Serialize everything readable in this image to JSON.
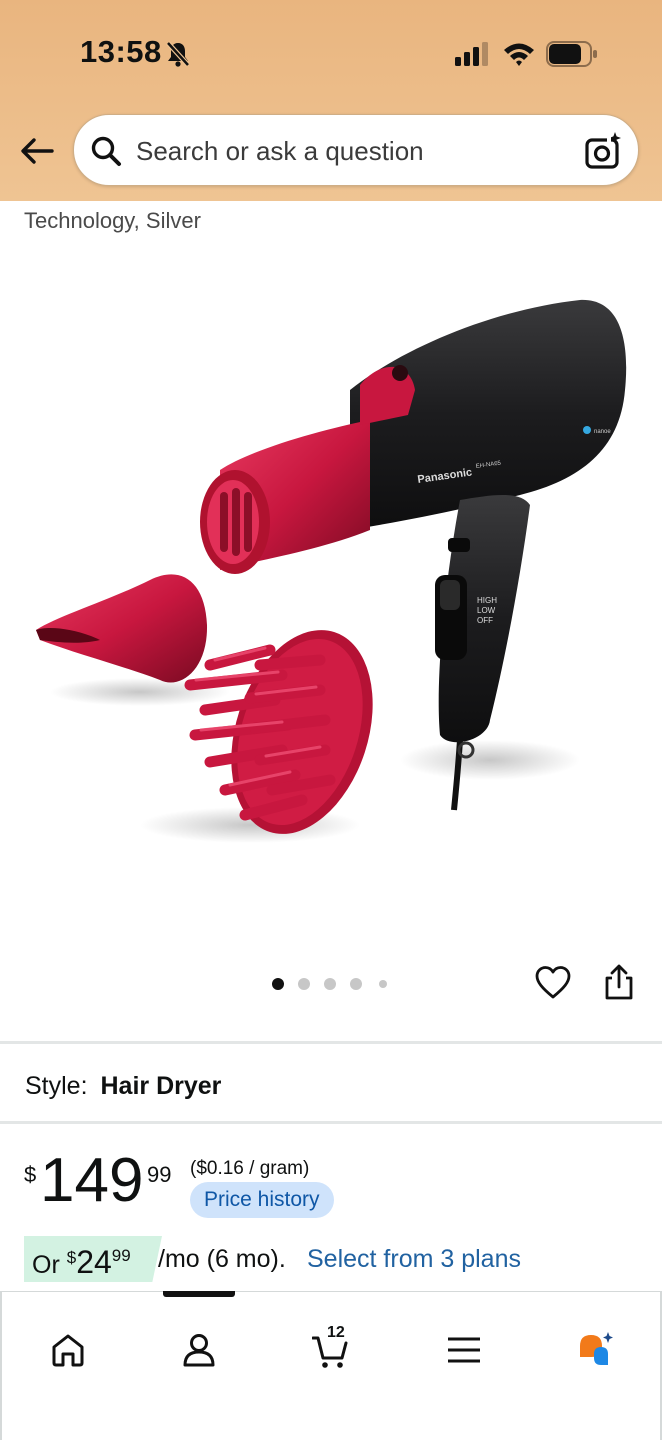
{
  "status_bar": {
    "time": "13:58"
  },
  "search": {
    "placeholder": "Search or ask a question"
  },
  "product": {
    "title_tail": "Technology, Silver",
    "style_label": "Style:",
    "style_value": "Hair Dryer",
    "image_count": 5,
    "active_image_index": 0
  },
  "price": {
    "symbol": "$",
    "whole": "149",
    "fraction": "99",
    "unit_price": "($0.16 / gram)",
    "price_history_label": "Price history"
  },
  "installment": {
    "prefix": "Or",
    "symbol": "$",
    "whole": "24",
    "fraction": "99",
    "term": "/mo (6 mo).",
    "select_plans": "Select from 3 plans"
  },
  "product_image": {
    "brand_text": "Panasonic",
    "model_text": "EH-NA65",
    "switch_labels": [
      "HIGH",
      "LOW",
      "OFF"
    ],
    "tag": "nanoe"
  },
  "bottom_nav": {
    "items": [
      "home-icon",
      "account-icon",
      "cart-icon",
      "menu-icon",
      "rufus-icon"
    ],
    "cart_count": "12",
    "active": "account"
  },
  "colors": {
    "header_bg": "#efc493",
    "link_blue": "#2162a1",
    "price_history_bg": "#cfe3fb",
    "installment_bg": "#d3f2e2",
    "dryer_red": "#c8173f"
  }
}
